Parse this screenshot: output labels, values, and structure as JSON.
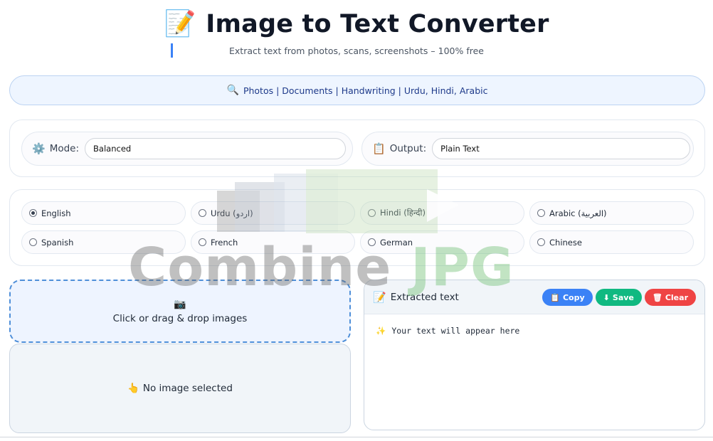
{
  "header": {
    "title_icon": "📝",
    "title": "Image to Text Converter",
    "subtitle": "Extract text from photos, scans, screenshots – 100% free"
  },
  "banner": {
    "icon": "🔍",
    "text": "Photos | Documents | Handwriting | Urdu, Hindi, Arabic"
  },
  "settings": {
    "mode": {
      "icon": "⚙️",
      "label": "Mode:",
      "value": "Balanced"
    },
    "output": {
      "icon": "📋",
      "label": "Output:",
      "value": "Plain Text"
    }
  },
  "languages": [
    {
      "label": "English",
      "selected": true
    },
    {
      "label": "Urdu (اردو)",
      "selected": false
    },
    {
      "label": "Hindi (हिन्दी)",
      "selected": false
    },
    {
      "label": "Arabic (العربية)",
      "selected": false
    },
    {
      "label": "Spanish",
      "selected": false
    },
    {
      "label": "French",
      "selected": false
    },
    {
      "label": "German",
      "selected": false
    },
    {
      "label": "Chinese",
      "selected": false
    }
  ],
  "upload": {
    "icon": "📷",
    "text": "Click or drag & drop images"
  },
  "preview": {
    "icon": "👆",
    "text": "No image selected"
  },
  "output_panel": {
    "icon": "📝",
    "title": "Extracted text",
    "copy": {
      "icon": "📋",
      "label": "Copy"
    },
    "save": {
      "icon": "⬇",
      "label": "Save"
    },
    "clear": {
      "icon": "🗑",
      "label": "Clear"
    },
    "placeholder_icon": "✨",
    "placeholder": "Your text will appear here"
  },
  "watermark": {
    "part1": "Combine ",
    "part2": "JPG"
  }
}
